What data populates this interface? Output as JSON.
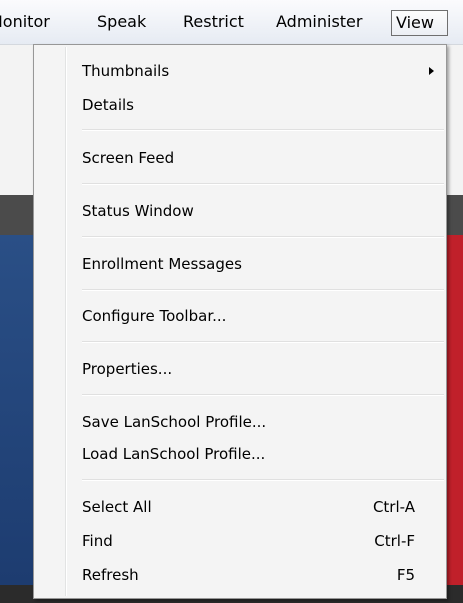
{
  "menubar": {
    "items": [
      {
        "label": "Monitor"
      },
      {
        "label": "Speak"
      },
      {
        "label": "Restrict"
      },
      {
        "label": "Administer"
      },
      {
        "label": "View"
      }
    ]
  },
  "view_menu": {
    "items": [
      {
        "label": "Thumbnails",
        "has_submenu": true
      },
      {
        "label": "Details"
      },
      {
        "label": "Screen Feed"
      },
      {
        "label": "Status Window"
      },
      {
        "label": "Enrollment Messages"
      },
      {
        "label": "Configure Toolbar..."
      },
      {
        "label": "Properties..."
      },
      {
        "label": "Save LanSchool Profile..."
      },
      {
        "label": "Load LanSchool Profile..."
      },
      {
        "label": "Select All",
        "shortcut": "Ctrl-A"
      },
      {
        "label": "Find",
        "shortcut": "Ctrl-F"
      },
      {
        "label": "Refresh",
        "shortcut": "F5"
      }
    ]
  }
}
